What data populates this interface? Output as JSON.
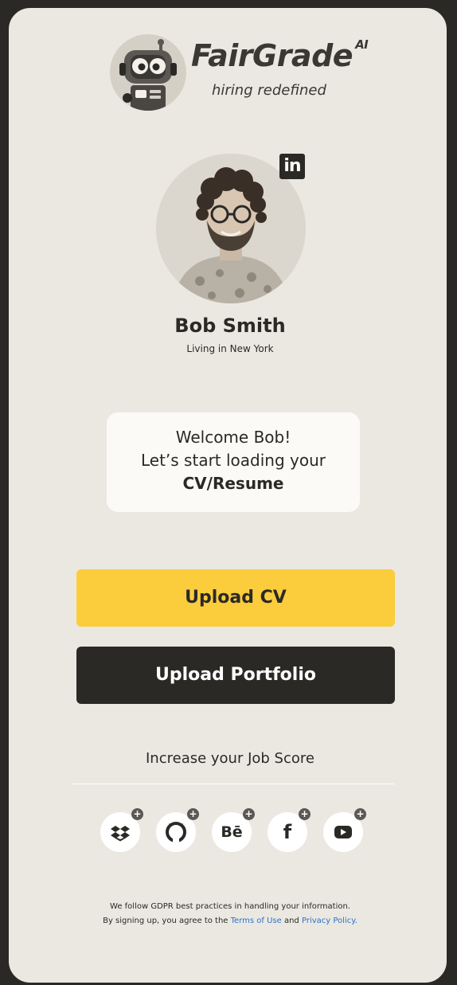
{
  "brand": {
    "name": "FairGrade",
    "superscript": "AI",
    "tagline": "hiring redefined"
  },
  "profile": {
    "name": "Bob Smith",
    "location": "Living in New York",
    "linkedin_label": "in"
  },
  "welcome": {
    "line1": "Welcome Bob!",
    "line2": "Let’s start loading your",
    "line3": "CV/Resume"
  },
  "actions": {
    "upload_cv": "Upload CV",
    "upload_portfolio": "Upload Portfolio"
  },
  "score": {
    "title": "Increase your Job Score",
    "plus_label": "+",
    "services": [
      {
        "icon": "dropbox-icon"
      },
      {
        "icon": "github-icon"
      },
      {
        "icon": "behance-icon",
        "label": "Bē"
      },
      {
        "icon": "facebook-icon",
        "label": "f"
      },
      {
        "icon": "youtube-icon"
      }
    ]
  },
  "footer": {
    "line1": "We follow GDPR best practices in handling your information.",
    "line2_prefix": "By signing up, you agree to the",
    "terms_link": "Terms of Use",
    "and_text": "and",
    "privacy_link": "Privacy Policy."
  },
  "colors": {
    "background": "#ebe8e1",
    "accent": "#fbcd3c",
    "dark": "#2b2926",
    "link": "#2a73c9"
  }
}
